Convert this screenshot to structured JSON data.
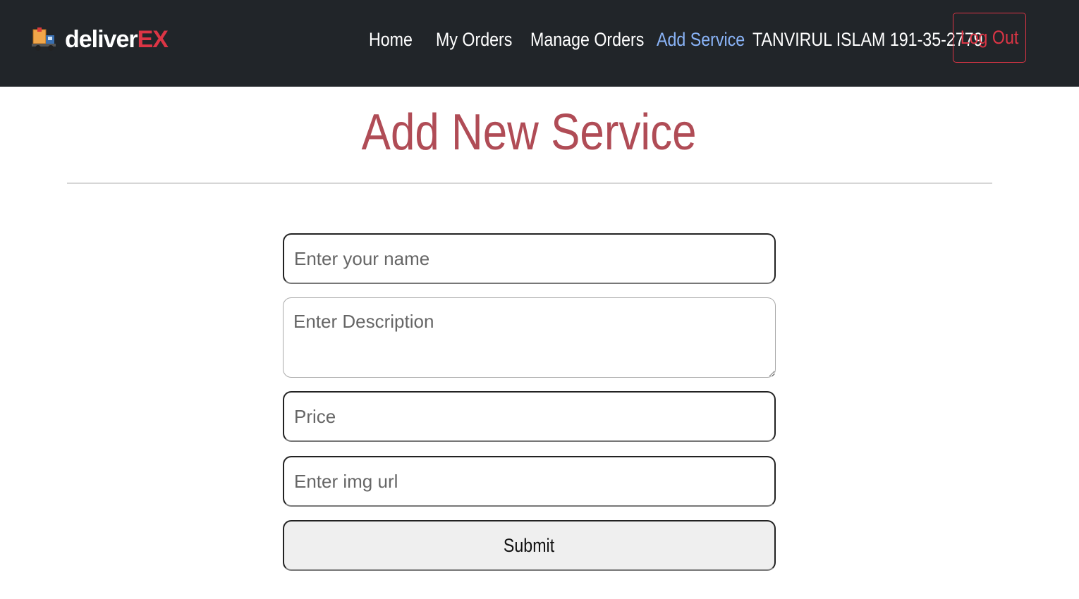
{
  "navbar": {
    "brand": {
      "main": "deliver",
      "accent": "EX",
      "logo_icon": "delivery-truck-icon",
      "accent_color": "#dc3545"
    },
    "links": [
      {
        "label": "Home",
        "active": false
      },
      {
        "label": "My Orders",
        "active": false
      },
      {
        "label": "Manage Orders",
        "active": false
      },
      {
        "label": "Add Service",
        "active": true
      }
    ],
    "user": "TANVIRUL ISLAM 191-35-2779",
    "logout_label": "Log Out",
    "background": "#212529"
  },
  "main": {
    "title": "Add New Service",
    "title_color": "#b04c56",
    "form": {
      "name_placeholder": "Enter your name",
      "description_placeholder": "Enter Description",
      "price_placeholder": "Price",
      "img_placeholder": "Enter img url",
      "submit_label": "Submit"
    }
  }
}
